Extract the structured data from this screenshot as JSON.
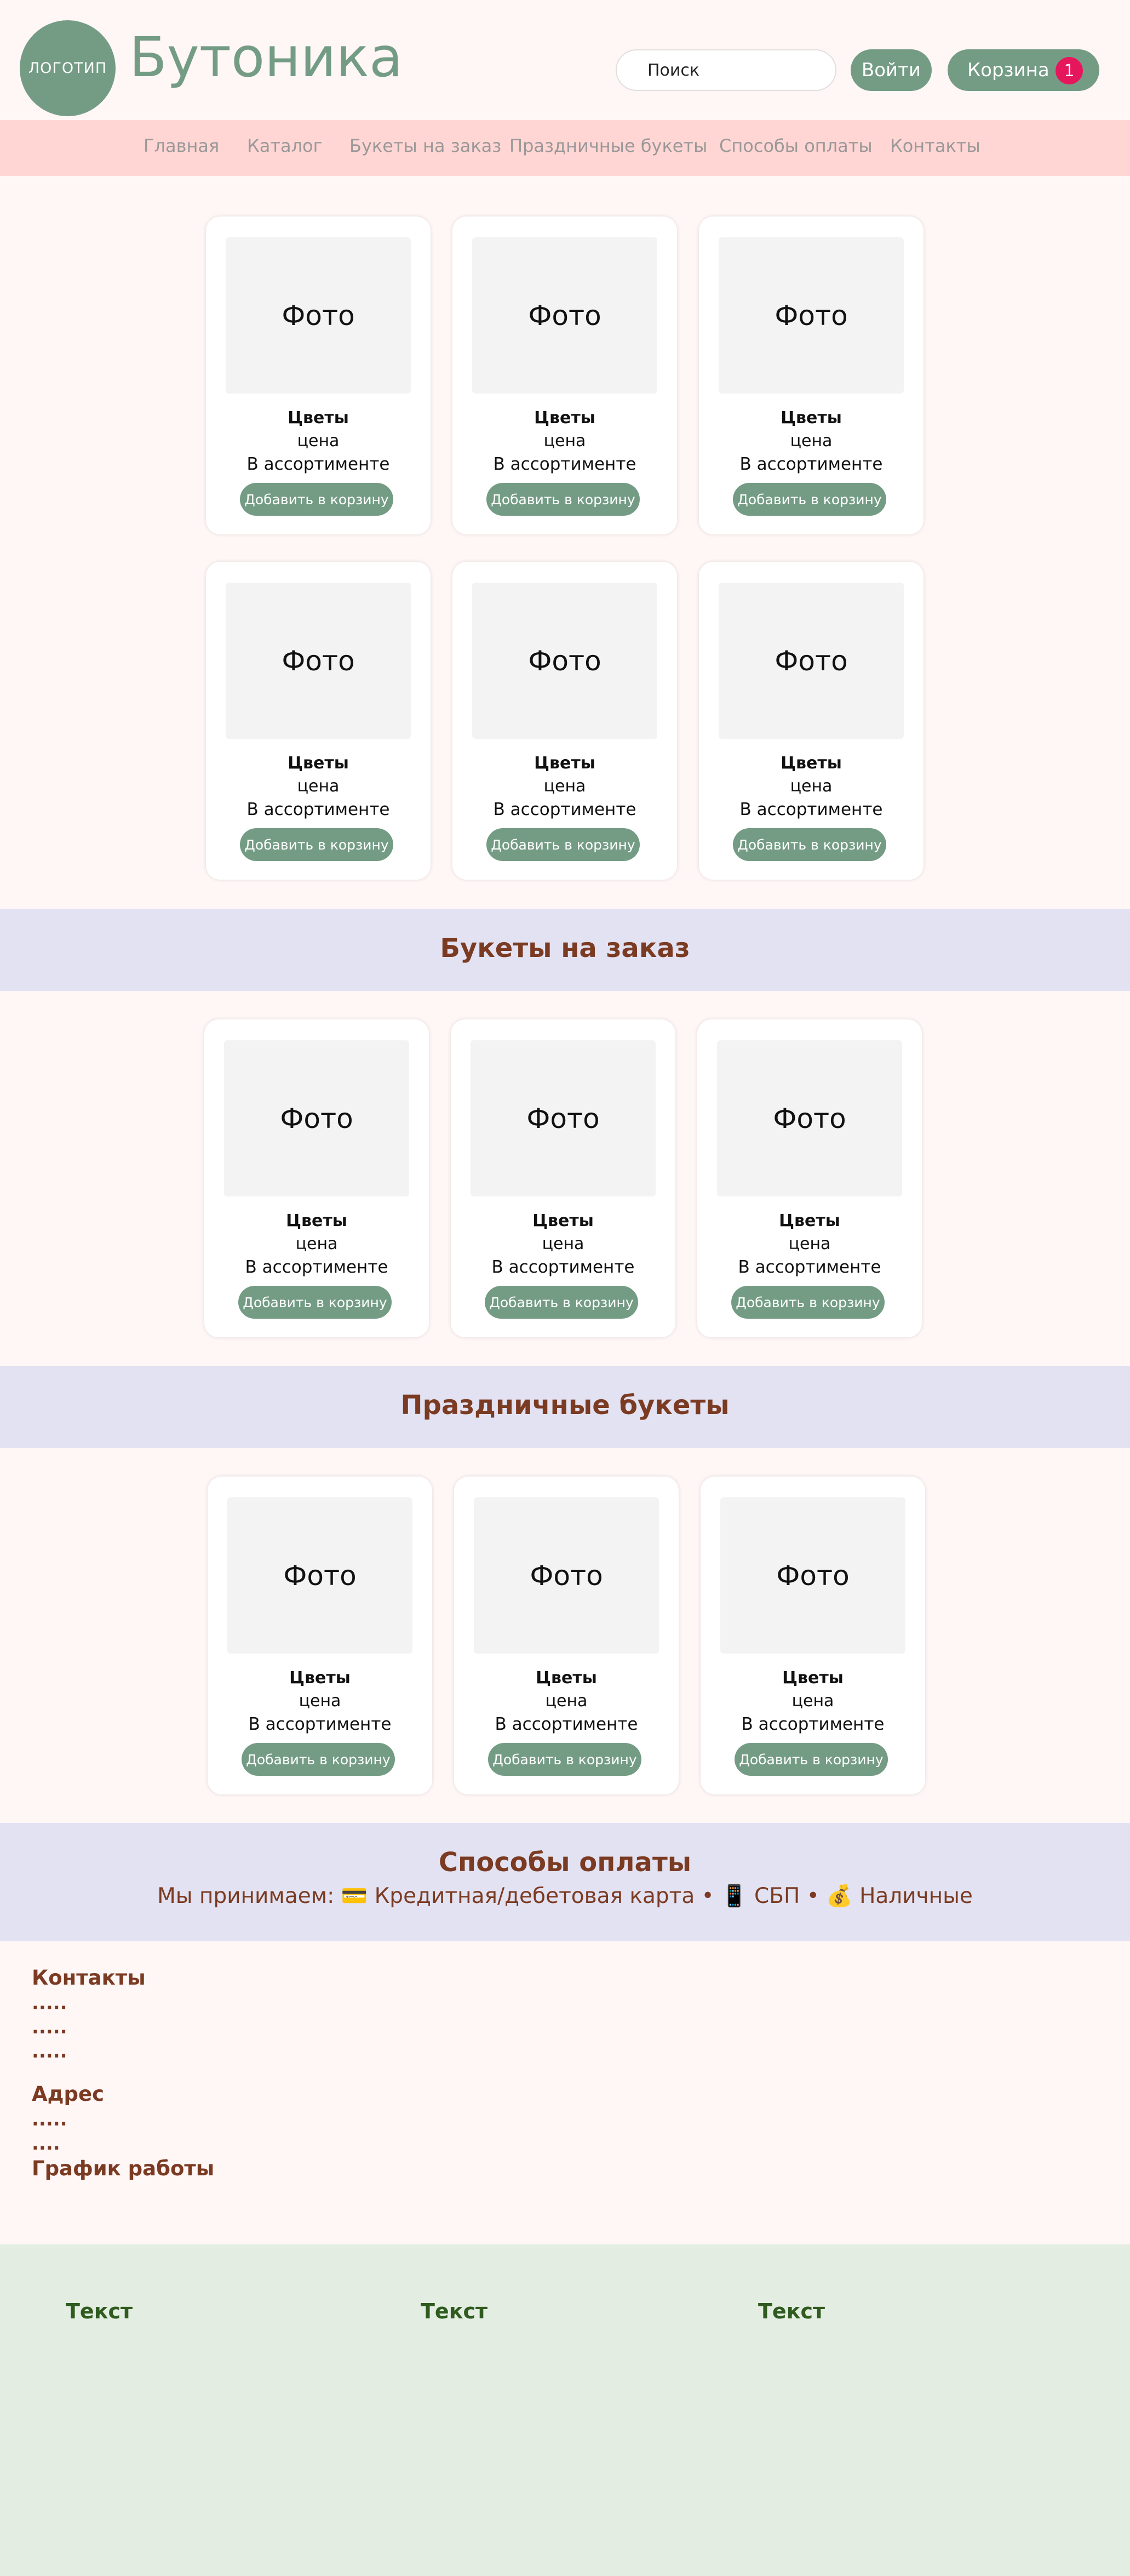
{
  "header": {
    "logo_text": "ЛОГОТИП",
    "brand": "Бутоника",
    "search_placeholder": "Поиск",
    "login_label": "Войти",
    "cart_label": "Корзина",
    "cart_count": "1"
  },
  "nav": {
    "items": [
      "Главная",
      "Каталог",
      "Букеты на заказ",
      "Праздничные букеты",
      "Способы оплаты",
      "Контакты"
    ]
  },
  "product_card": {
    "photo": "Фото",
    "name": "Цветы",
    "price": "цена",
    "stock": "В ассортименте",
    "add_label": "Добавить в корзину"
  },
  "sections": {
    "custom_title": "Букеты на заказ",
    "holiday_title": "Праздничные букеты",
    "payment_title": "Способы оплаты",
    "payment_text": "Мы принимаем: 💳 Кредитная/дебетовая карта • 📱 СБП • 💰 Наличные"
  },
  "contacts": {
    "title": "Контакты",
    "lines": [
      ".....",
      ".....",
      "....."
    ],
    "address_title": "Адрес",
    "address_lines": [
      ".....",
      "...."
    ],
    "hours_title": "График работы"
  },
  "footer": {
    "col1": "Текст",
    "col2": "Текст",
    "col3": "Текст"
  },
  "colors": {
    "accent": "#749c85",
    "nav_bg": "#ffd6d4",
    "band_bg": "#e2e2f2",
    "heading": "#7b3b22",
    "badge": "#e6165d",
    "footer_bg": "#e3ede2"
  }
}
